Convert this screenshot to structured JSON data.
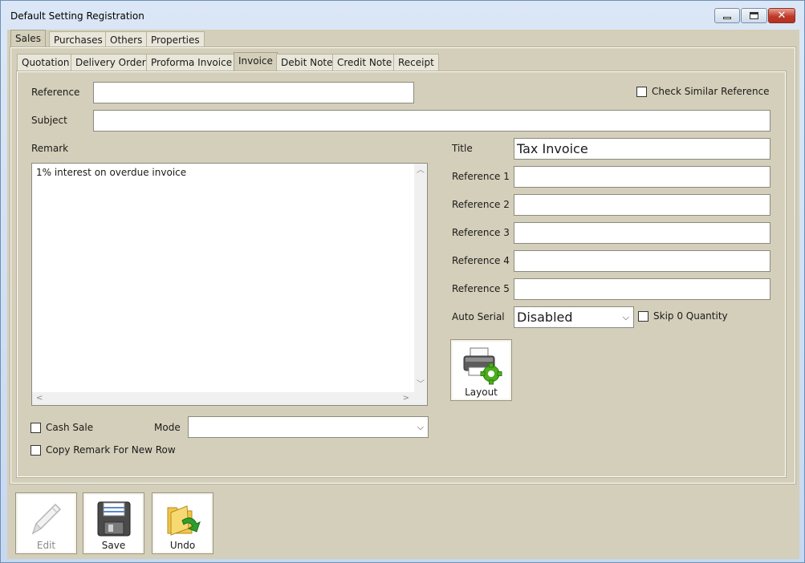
{
  "window": {
    "title": "Default Setting Registration"
  },
  "main_tabs": [
    {
      "label": "Sales",
      "active": true
    },
    {
      "label": "Purchases",
      "active": false
    },
    {
      "label": "Others",
      "active": false
    },
    {
      "label": "Properties",
      "active": false
    }
  ],
  "sub_tabs": [
    {
      "label": "Quotation",
      "active": false
    },
    {
      "label": "Delivery Order",
      "active": false
    },
    {
      "label": "Proforma Invoice",
      "active": false
    },
    {
      "label": "Invoice",
      "active": true
    },
    {
      "label": "Debit Note",
      "active": false
    },
    {
      "label": "Credit Note",
      "active": false
    },
    {
      "label": "Receipt",
      "active": false
    }
  ],
  "form": {
    "reference_label": "Reference",
    "reference_value": "",
    "check_similar_label": "Check Similar Reference",
    "check_similar_checked": false,
    "subject_label": "Subject",
    "subject_value": "",
    "remark_label": "Remark",
    "remark_value": "1% interest on overdue invoice",
    "title_label": "Title",
    "title_value": "Tax Invoice",
    "ref1_label": "Reference 1",
    "ref1_value": "",
    "ref2_label": "Reference 2",
    "ref2_value": "",
    "ref3_label": "Reference 3",
    "ref3_value": "",
    "ref4_label": "Reference 4",
    "ref4_value": "",
    "ref5_label": "Reference 5",
    "ref5_value": "",
    "auto_serial_label": "Auto Serial",
    "auto_serial_value": "Disabled",
    "skip_zero_label": "Skip 0 Quantity",
    "skip_zero_checked": false,
    "layout_label": "Layout",
    "cash_sale_label": "Cash Sale",
    "cash_sale_checked": false,
    "mode_label": "Mode",
    "mode_value": "",
    "copy_remark_label": "Copy Remark For New Row",
    "copy_remark_checked": false
  },
  "toolbar": {
    "edit_label": "Edit",
    "save_label": "Save",
    "undo_label": "Undo"
  },
  "icons": {
    "edit": "pencil-icon",
    "save": "floppy-disk-icon",
    "undo": "folder-undo-icon",
    "layout": "printer-gear-icon"
  },
  "colors": {
    "panel": "#d4cfba",
    "gear_green": "#4caf1e",
    "undo_green": "#2e9e2e",
    "close_red": "#c0392b"
  }
}
